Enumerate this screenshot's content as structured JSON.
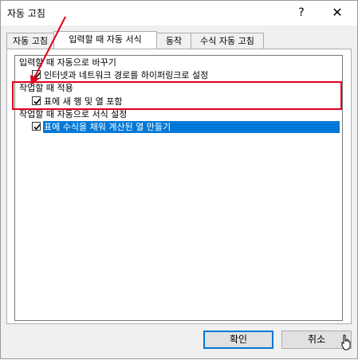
{
  "window": {
    "title": "자동 고침",
    "help": "?",
    "close": "✕"
  },
  "tabs": [
    {
      "label": "자동 고침",
      "active": false
    },
    {
      "label": "입력할 때 자동 서식",
      "active": true
    },
    {
      "label": "동작",
      "active": false
    },
    {
      "label": "수식 자동 고침",
      "active": false
    }
  ],
  "groups": {
    "as_you_type_replace": "입력할 때 자동으로 바꾸기",
    "apply_as_you_work": "작업할 때 적용",
    "auto_format_as_you_work": "작업할 때 자동으로 서식 설정"
  },
  "options": {
    "hyperlinks": {
      "label": "인터넷과 네트워크 경로를 하이퍼링크로 설정",
      "checked": true
    },
    "include_rows_cols": {
      "label": "표에 새 행 및 열 포함",
      "checked": true
    },
    "calc_columns": {
      "label": "표에 수식을 채워 계산된 열 만들기",
      "checked": true,
      "selected": true
    }
  },
  "buttons": {
    "ok": "확인",
    "cancel": "취소"
  },
  "colors": {
    "highlight_box": "#e0001b",
    "selection": "#0078d7"
  }
}
